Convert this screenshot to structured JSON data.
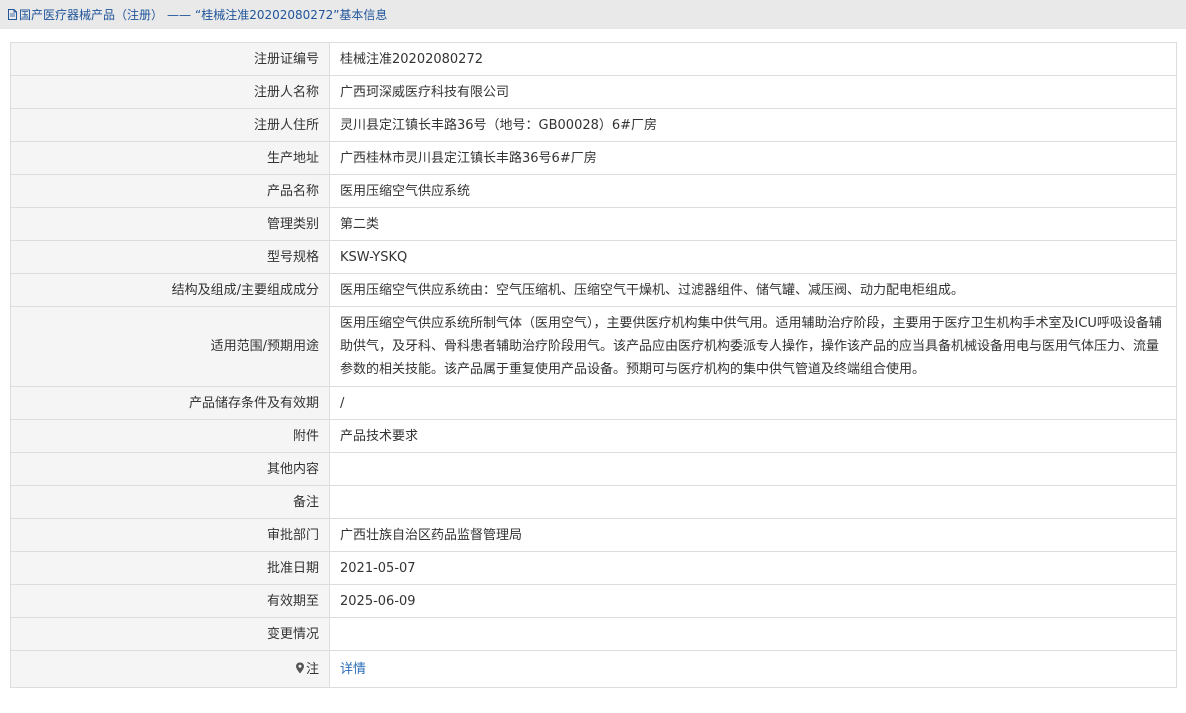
{
  "breadcrumb": {
    "prefix": "国产医疗器械产品（注册）",
    "separator": "——",
    "title": "“桂械注准20202080272”基本信息",
    "icon": "document-icon"
  },
  "rows": [
    {
      "label": "注册证编号",
      "value": "桂械注准20202080272"
    },
    {
      "label": "注册人名称",
      "value": "广西珂深威医疗科技有限公司"
    },
    {
      "label": "注册人住所",
      "value": "灵川县定江镇长丰路36号（地号：GB00028）6#厂房"
    },
    {
      "label": "生产地址",
      "value": "广西桂林市灵川县定江镇长丰路36号6#厂房"
    },
    {
      "label": "产品名称",
      "value": "医用压缩空气供应系统"
    },
    {
      "label": "管理类别",
      "value": "第二类"
    },
    {
      "label": "型号规格",
      "value": "KSW-YSKQ"
    },
    {
      "label": "结构及组成/主要组成成分",
      "value": "医用压缩空气供应系统由：空气压缩机、压缩空气干燥机、过滤器组件、储气罐、减压阀、动力配电柜组成。"
    },
    {
      "label": "适用范围/预期用途",
      "value": "医用压缩空气供应系统所制气体（医用空气），主要供医疗机构集中供气用。适用辅助治疗阶段，主要用于医疗卫生机构手术室及ICU呼吸设备辅助供气，及牙科、骨科患者辅助治疗阶段用气。该产品应由医疗机构委派专人操作，操作该产品的应当具备机械设备用电与医用气体压力、流量参数的相关技能。该产品属于重复使用产品设备。预期可与医疗机构的集中供气管道及终端组合使用。"
    },
    {
      "label": "产品储存条件及有效期",
      "value": "/"
    },
    {
      "label": "附件",
      "value": "产品技术要求"
    },
    {
      "label": "其他内容",
      "value": ""
    },
    {
      "label": "备注",
      "value": ""
    },
    {
      "label": "审批部门",
      "value": "广西壮族自治区药品监督管理局"
    },
    {
      "label": "批准日期",
      "value": "2021-05-07"
    },
    {
      "label": "有效期至",
      "value": "2025-06-09"
    },
    {
      "label": "变更情况",
      "value": ""
    }
  ],
  "note_row": {
    "icon": "map-pin-icon",
    "label": "注",
    "link_text": "详情"
  }
}
